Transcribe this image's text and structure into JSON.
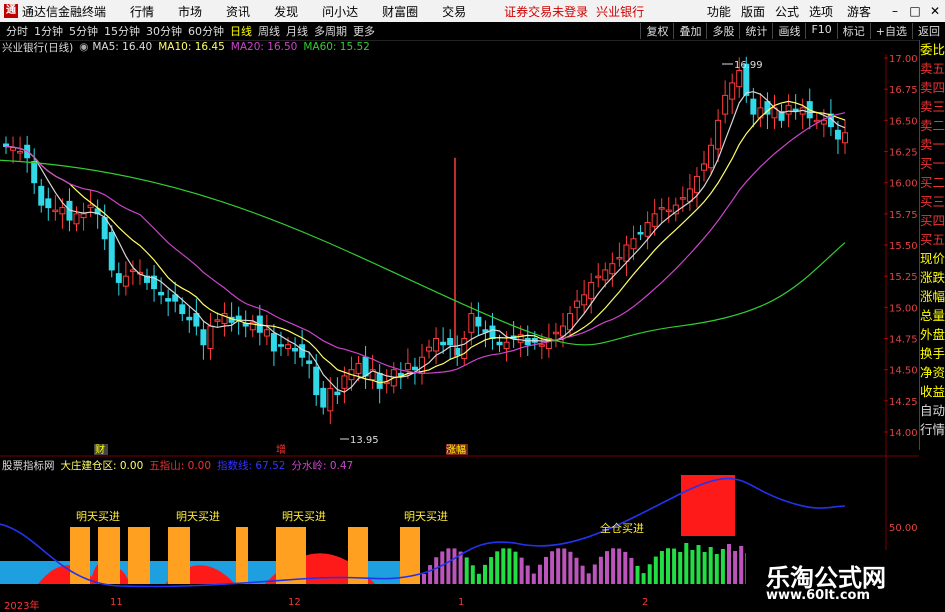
{
  "app": {
    "title": "通达信金融终端",
    "notice": "证券交易未登录",
    "stock_tab": "兴业银行"
  },
  "menu": [
    "行情",
    "市场",
    "资讯",
    "发现",
    "问小达",
    "财富圈",
    "交易"
  ],
  "right_menu": [
    "功能",
    "版面",
    "公式",
    "选项"
  ],
  "guest": "游客",
  "periods": [
    "分时",
    "1分钟",
    "5分钟",
    "15分钟",
    "30分钟",
    "60分钟",
    "日线",
    "周线",
    "月线",
    "多周期",
    "更多"
  ],
  "active_period": "日线",
  "toolbar_right": [
    "复权",
    "叠加",
    "多股",
    "统计",
    "画线",
    "F10",
    "标记",
    "+自选",
    "返回"
  ],
  "main_title": {
    "name": "兴业银行(日线)",
    "ma5": "MA5: 16.40",
    "ma10": "MA10: 16.45",
    "ma20": "MA20: 16.50",
    "ma60": "MA60: 15.52"
  },
  "price_axis": [
    "17.00",
    "16.75",
    "16.50",
    "16.25",
    "16.00",
    "15.75",
    "15.50",
    "15.25",
    "15.00",
    "14.75",
    "14.50",
    "14.25",
    "14.00"
  ],
  "labels": {
    "high": "16.99",
    "low": "13.95",
    "marker1": "财",
    "marker2": "增",
    "marker3": "涨幅"
  },
  "sidebar": [
    "委比",
    "卖五",
    "卖四",
    "卖三",
    "卖二",
    "卖一",
    "买一",
    "买二",
    "买三",
    "买四",
    "买五",
    "现价",
    "涨跌",
    "涨幅",
    "总量",
    "外盘",
    "换手",
    "净资",
    "收益",
    "",
    "自动",
    "行情"
  ],
  "sub_title": {
    "name": "股票指标网",
    "a": "大庄建仓区: 0.00",
    "b": "五指山: 0.00",
    "c": "指数线: 67.52",
    "d": "分水岭: 0.47"
  },
  "sub_axis": "50.00",
  "sub_labels": [
    "明天买进",
    "明天买进",
    "明天买进",
    "明天买进",
    "全仓买进"
  ],
  "time_axis": [
    "2023年",
    "11",
    "12",
    "1",
    "2"
  ],
  "watermark": {
    "line1": "乐淘公式网",
    "line2": "www.60lt.com"
  },
  "chart_data": {
    "type": "candlestick",
    "ylim": [
      13.9,
      17.1
    ],
    "ma_colors": {
      "MA5": "#d8d8d8",
      "MA10": "#ffff66",
      "MA20": "#cc44cc",
      "MA60": "#33cc33"
    }
  }
}
